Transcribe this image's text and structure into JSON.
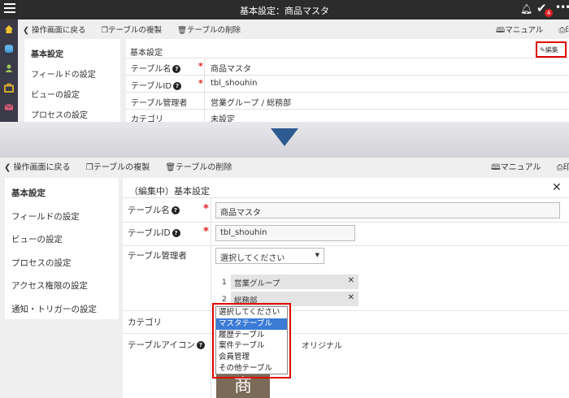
{
  "top": {
    "title": "基本設定：商品マスタ",
    "badge_count": "4"
  },
  "toolbar1": {
    "back": "操作画面に戻る",
    "copy": "テーブルの複製",
    "delete": "テーブルの削除",
    "manual": "マニュアル",
    "print": "印刷"
  },
  "sidenav1": [
    "基本設定",
    "フィールドの設定",
    "ビューの設定",
    "プロセスの設定"
  ],
  "panel1": {
    "title": "基本設定",
    "edit_label": "編集",
    "rows": [
      {
        "label": "テーブル名",
        "required": true,
        "help": true,
        "value": "商品マスタ"
      },
      {
        "label": "テーブルID",
        "required": true,
        "help": true,
        "value": "tbl_shouhin"
      },
      {
        "label": "テーブル管理者",
        "required": false,
        "help": false,
        "value": "営業グループ / 総務部"
      },
      {
        "label": "カテゴリ",
        "required": false,
        "help": false,
        "value": "未設定"
      }
    ]
  },
  "toolbar2": {
    "back": "操作画面に戻る",
    "copy": "テーブルの複製",
    "delete": "テーブルの削除",
    "manual": "マニュアル",
    "print": "印刷"
  },
  "sidenav2": [
    "基本設定",
    "フィールドの設定",
    "ビューの設定",
    "プロセスの設定",
    "アクセス権限の設定",
    "通知・トリガーの設定"
  ],
  "panel2": {
    "title": "（編集中）基本設定",
    "table_name_label": "テーブル名",
    "table_name_value": "商品マスタ",
    "table_id_label": "テーブルID",
    "table_id_value": "tbl_shouhin",
    "admin_label": "テーブル管理者",
    "admin_select": "選択してください",
    "admins": [
      {
        "num": "1",
        "name": "営業グループ"
      },
      {
        "num": "2",
        "name": "総務部"
      }
    ],
    "category_label": "カテゴリ",
    "icon_label": "テーブルアイコン",
    "icon_option_text": "オリジナル",
    "icon_glyph": "商"
  },
  "dropdown": {
    "options": [
      "選択してください",
      "マスタテーブル",
      "履歴テーブル",
      "案件テーブル",
      "会員管理",
      "その他テーブル"
    ],
    "selected_index": 1
  },
  "colors": {
    "accent": "#3b7bd6",
    "highlight": "#e00000",
    "arrow": "#2d5a91"
  }
}
